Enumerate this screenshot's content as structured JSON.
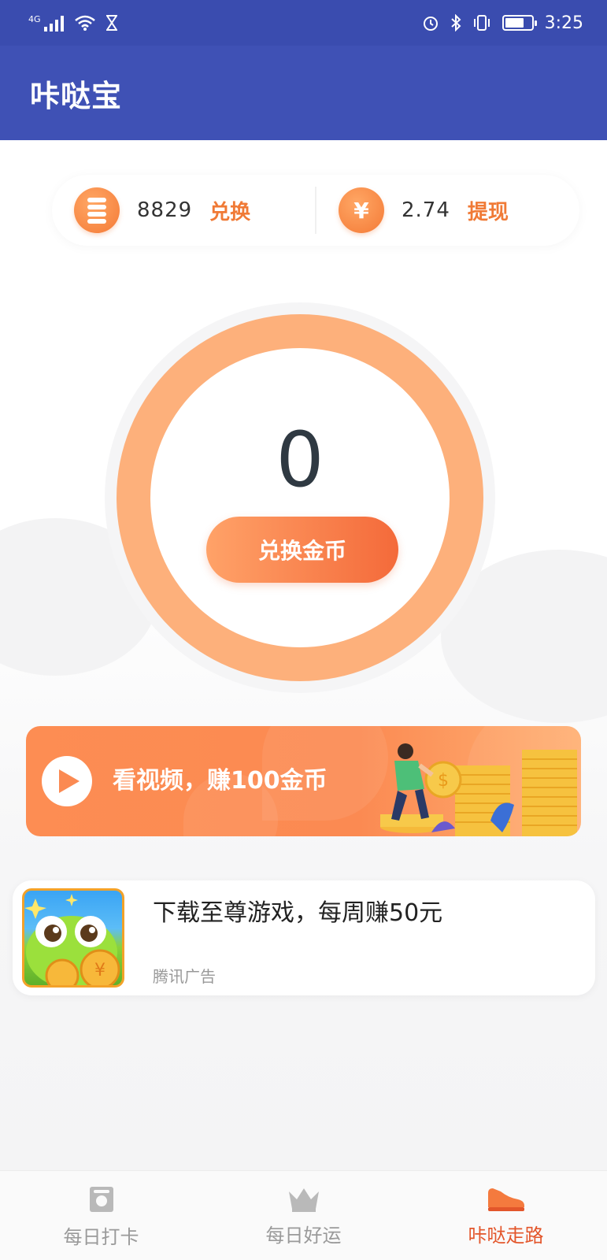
{
  "status_bar": {
    "network": "4G",
    "time": "3:25",
    "battery_level": 0.7
  },
  "app_bar": {
    "title": "咔哒宝"
  },
  "balance": {
    "coins": "8829",
    "coins_action": "兑换",
    "cash_symbol": "¥",
    "cash": "2.74",
    "cash_action": "提现"
  },
  "steps": {
    "count": "0",
    "button_label": "兑换金币"
  },
  "video_banner": {
    "text": "看视频，赚100金币"
  },
  "ad": {
    "title": "下载至尊游戏，每周赚50元",
    "source": "腾讯广告"
  },
  "bottom_nav": {
    "items": [
      {
        "label": "每日打卡",
        "icon": "checkin-card-icon",
        "active": false
      },
      {
        "label": "每日好运",
        "icon": "crown-icon",
        "active": false
      },
      {
        "label": "咔哒走路",
        "icon": "sneaker-icon",
        "active": true
      }
    ]
  },
  "colors": {
    "status_bar": "#3a4caf",
    "app_bar": "#3f51b5",
    "accent_orange": "#f07a36",
    "ring": "#fdb07b",
    "nav_active": "#e3562b"
  }
}
